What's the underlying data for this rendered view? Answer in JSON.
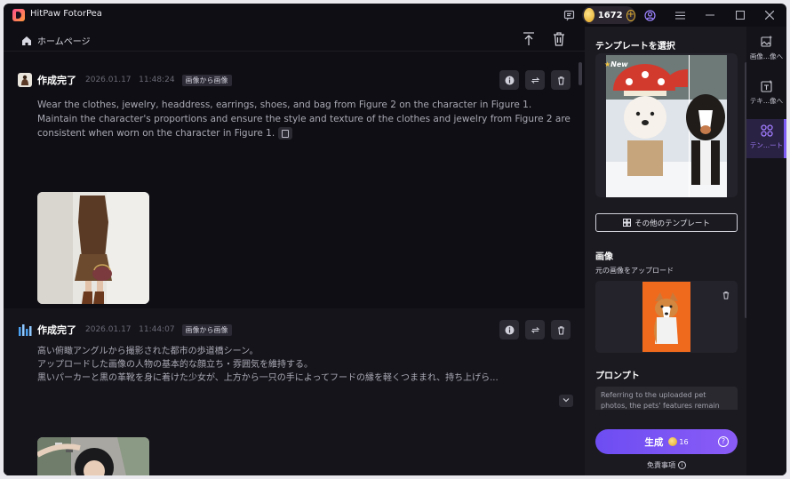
{
  "app": {
    "title": "HitPaw FotorPea",
    "coins": "1672"
  },
  "breadcrumb": {
    "home": "ホームページ"
  },
  "cards": [
    {
      "status": "作成完了",
      "date": "2026.01.17",
      "time": "11:48:24",
      "badge": "画像から画像",
      "prompt": "Wear the clothes, jewelry, headdress, earrings, shoes, and bag from Figure 2 on the character in Figure 1. Maintain the character's proportions and ensure the style and texture of the clothes and jewelry from Figure 2 are consistent when worn on the character in Figure 1."
    },
    {
      "status": "作成完了",
      "date": "2026.01.17",
      "time": "11:44:07",
      "badge": "画像から画像",
      "lines": [
        "高い俯瞰アングルから撮影された都市の歩道橋シーン。",
        "アップロードした画像の人物の基本的な顔立ち・雰囲気を維持する。",
        "黒いパーカーと黒の革靴を身に着けた少女が、上方から一只の手によってフードの縁を軽くつままれ、持ち上げら..."
      ]
    }
  ],
  "panel": {
    "template_title": "テンプレートを選択",
    "new_badge": "New",
    "more_templates": "その他のテンプレート",
    "image_label": "画像",
    "image_sub": "元の画像をアップロード",
    "prompt_label": "プロンプト",
    "prompt_text": "Referring to the uploaded pet photos, the pets' features remain",
    "generate": "生成",
    "generate_cost": "16",
    "disclaimer": "免責事項"
  },
  "sidenav": [
    {
      "label": "画像...像へ"
    },
    {
      "label": "テキ...像へ"
    },
    {
      "label": "テン...ート"
    }
  ],
  "colors": {
    "accent": "#7d5cf6",
    "bg": "#0f0e14",
    "panel": "#1b1a21"
  }
}
